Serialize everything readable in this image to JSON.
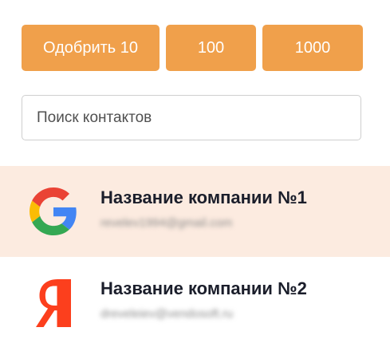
{
  "toolbar": {
    "approve_10_label": "Одобрить 10",
    "approve_100_label": "100",
    "approve_1000_label": "1000"
  },
  "search": {
    "placeholder": "Поиск контактов"
  },
  "contacts": [
    {
      "name": "Название компании №1",
      "email": "revelev1994@gmail.com",
      "logo": "google-logo-icon",
      "selected": true
    },
    {
      "name": "Название компании №2",
      "email": "dreveleiev@vendosoft.ru",
      "logo": "yandex-logo-icon",
      "selected": false
    }
  ],
  "colors": {
    "accent": "#f0a04b",
    "selected_row": "#fcebe0",
    "text_primary": "#1b1e2b",
    "google_blue": "#4285F4",
    "google_red": "#EA4335",
    "google_yellow": "#FBBC05",
    "google_green": "#34A853",
    "yandex_red": "#FC3F1D"
  }
}
